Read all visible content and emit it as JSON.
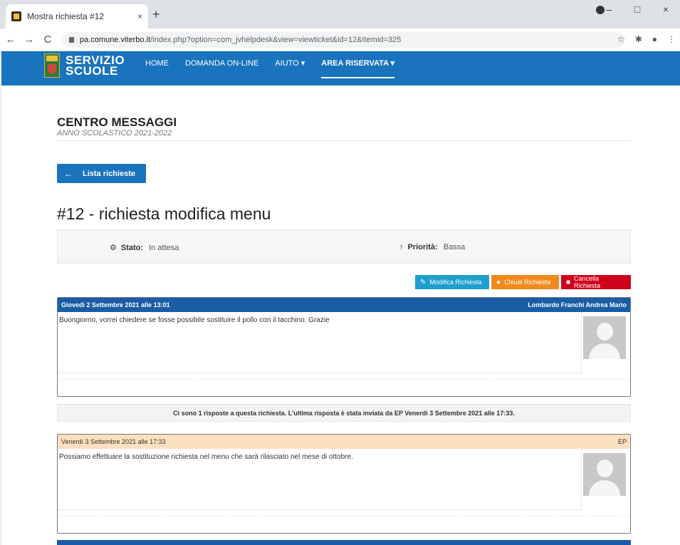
{
  "browser": {
    "tab_title": "Mostra richiesta #12",
    "tab_close": "×",
    "new_tab": "+",
    "url_domain": "pa.comune.viterbo.it",
    "url_path": "/index.php?option=com_jvhelpdesk&view=viewticket&id=12&Itemid=325",
    "back": "←",
    "forward": "→",
    "reload": "C",
    "minimize": "–",
    "maximize": "□",
    "close": "×"
  },
  "header": {
    "brand_line1": "SERVIZIO",
    "brand_line2": "SCUOLE",
    "nav": [
      "HOME",
      "DOMANDA ON-LINE",
      "AIUTO ▾",
      "AREA RISERVATA ▾"
    ],
    "active_nav": "AREA RISERVATA ▾"
  },
  "page": {
    "title": "CENTRO MESSAGGI",
    "subtitle": "ANNO SCOLASTICO 2021-2022",
    "back_button": "Lista richieste",
    "ticket_title": "#12 - richiesta modifica menu"
  },
  "info": {
    "stato_label": "Stato:",
    "stato_value": "In attesa",
    "priorita_label": "Priorità:",
    "priorita_value": "Bassa"
  },
  "actions": {
    "edit": "Modifica Richiesta",
    "close": "Chiudi Richiesta",
    "delete": "Cancella Richiesta"
  },
  "messages": [
    {
      "date": "Giovedì 2 Settembre 2021 alle 13:01",
      "author": "Lombardo Franchi Andrea Mario",
      "text": "Buongiorno, vorrei chiedere se fosse possibile sostituire il pollo con il tacchino. Grazie"
    },
    {
      "date": "Venerdì 3 Settembre 2021 alle 17:33",
      "author": "EP",
      "text": "Possiamo effettuare la sostituzione richiesta nel menu che sarà rilasciato nel mese di ottobre."
    }
  ],
  "reply_info": "Ci sono 1 risposte a questa richiesta. L'ultima risposta è stata inviata da EP Venerdì 3 Settembre 2021 alle 17:33.",
  "colors": {
    "header_blue": "#1a73bd",
    "msg_head_blue": "#1a5da6",
    "msg_head_reply": "#fce0be",
    "btn_edit": "#1e9fcf",
    "btn_close": "#f08a1e",
    "btn_delete": "#d0021b"
  }
}
